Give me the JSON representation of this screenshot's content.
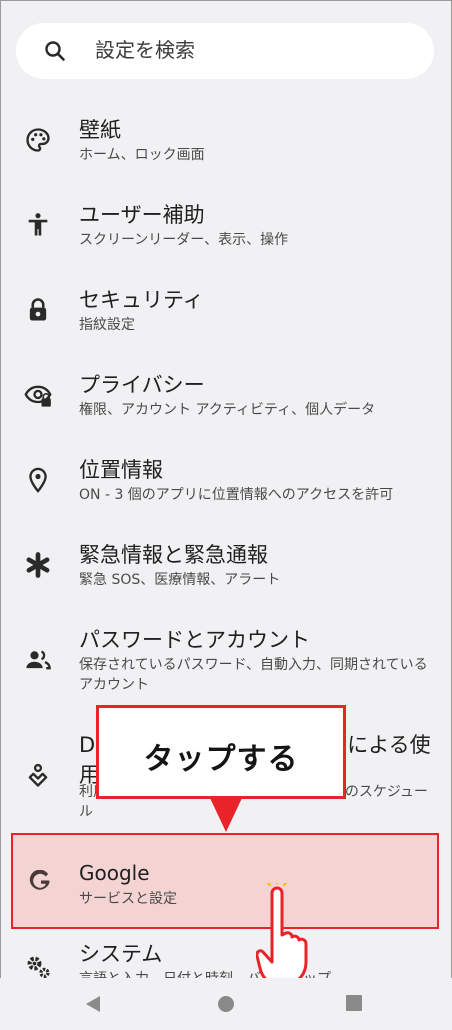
{
  "search": {
    "placeholder": "設定を検索"
  },
  "items": [
    {
      "title": "壁紙",
      "subtitle": "ホーム、ロック画面",
      "icon": "palette-icon"
    },
    {
      "title": "ユーザー補助",
      "subtitle": "スクリーンリーダー、表示、操作",
      "icon": "accessibility-icon"
    },
    {
      "title": "セキュリティ",
      "subtitle": "指紋設定",
      "icon": "lock-icon"
    },
    {
      "title": "プライバシー",
      "subtitle": "権限、アカウント アクティビティ、個人データ",
      "icon": "privacy-eye-icon"
    },
    {
      "title": "位置情報",
      "subtitle": "ON - 3 個のアプリに位置情報へのアクセスを許可",
      "icon": "location-pin-icon"
    },
    {
      "title": "緊急情報と緊急通報",
      "subtitle": "緊急 SOS、医療情報、アラート",
      "icon": "asterisk-icon"
    },
    {
      "title": "パスワードとアカウント",
      "subtitle": "保存されているパスワード、自動入力、同期されているアカウント",
      "icon": "accounts-icon"
    },
    {
      "title": "Digital Wellbeing と保護者による使用制限",
      "subtitle": "利用時間、アプリタイマー、おやすみ時間のスケジュール",
      "icon": "wellbeing-icon"
    },
    {
      "title": "Google",
      "subtitle": "サービスと設定",
      "icon": "google-g-icon"
    },
    {
      "title": "システム",
      "subtitle": "言語と入力、日付と時刻、バックアップ",
      "icon": "system-gears-icon"
    }
  ],
  "annotation": {
    "callout": "タップする"
  },
  "colors": {
    "highlight_border": "#e8232a",
    "highlight_fill": "#f4d3d3",
    "background": "#f1f1f3"
  }
}
